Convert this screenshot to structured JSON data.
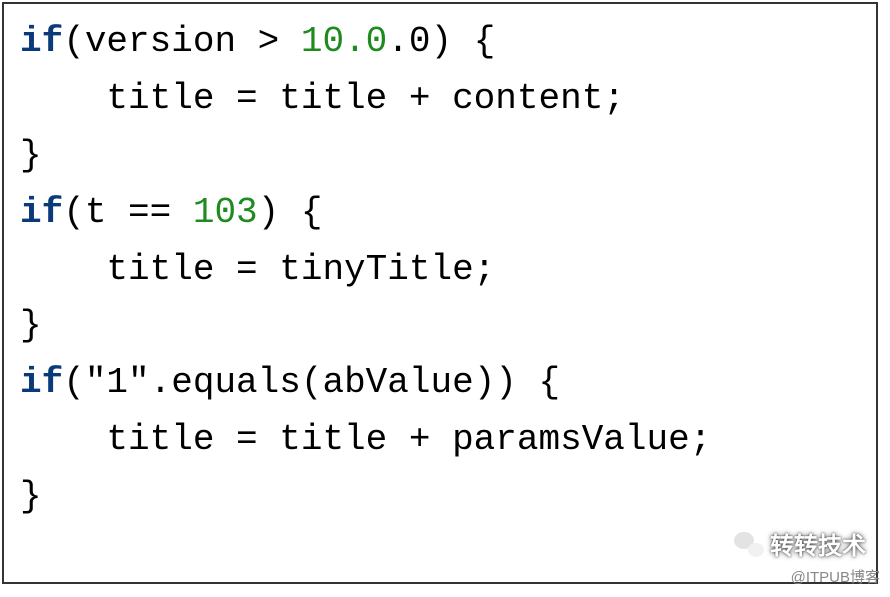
{
  "code": {
    "l1": {
      "kw": "if",
      "open": "(version > ",
      "num": "10.0",
      "tail_num": ".0",
      "close": ") {"
    },
    "l2": "    title = title + content;",
    "l3": "}",
    "l4": {
      "kw": "if",
      "open": "(t == ",
      "num": "103",
      "close": ") {"
    },
    "l5": "    title = tinyTitle;",
    "l6": "}",
    "l7": {
      "kw": "if",
      "open": "(",
      "str": "\"1\"",
      "method": ".equals(abValue)) {"
    },
    "l8": "    title = title + paramsValue;",
    "l9": "}"
  },
  "watermark": "转转技术",
  "attribution": "@ITPUB博客"
}
